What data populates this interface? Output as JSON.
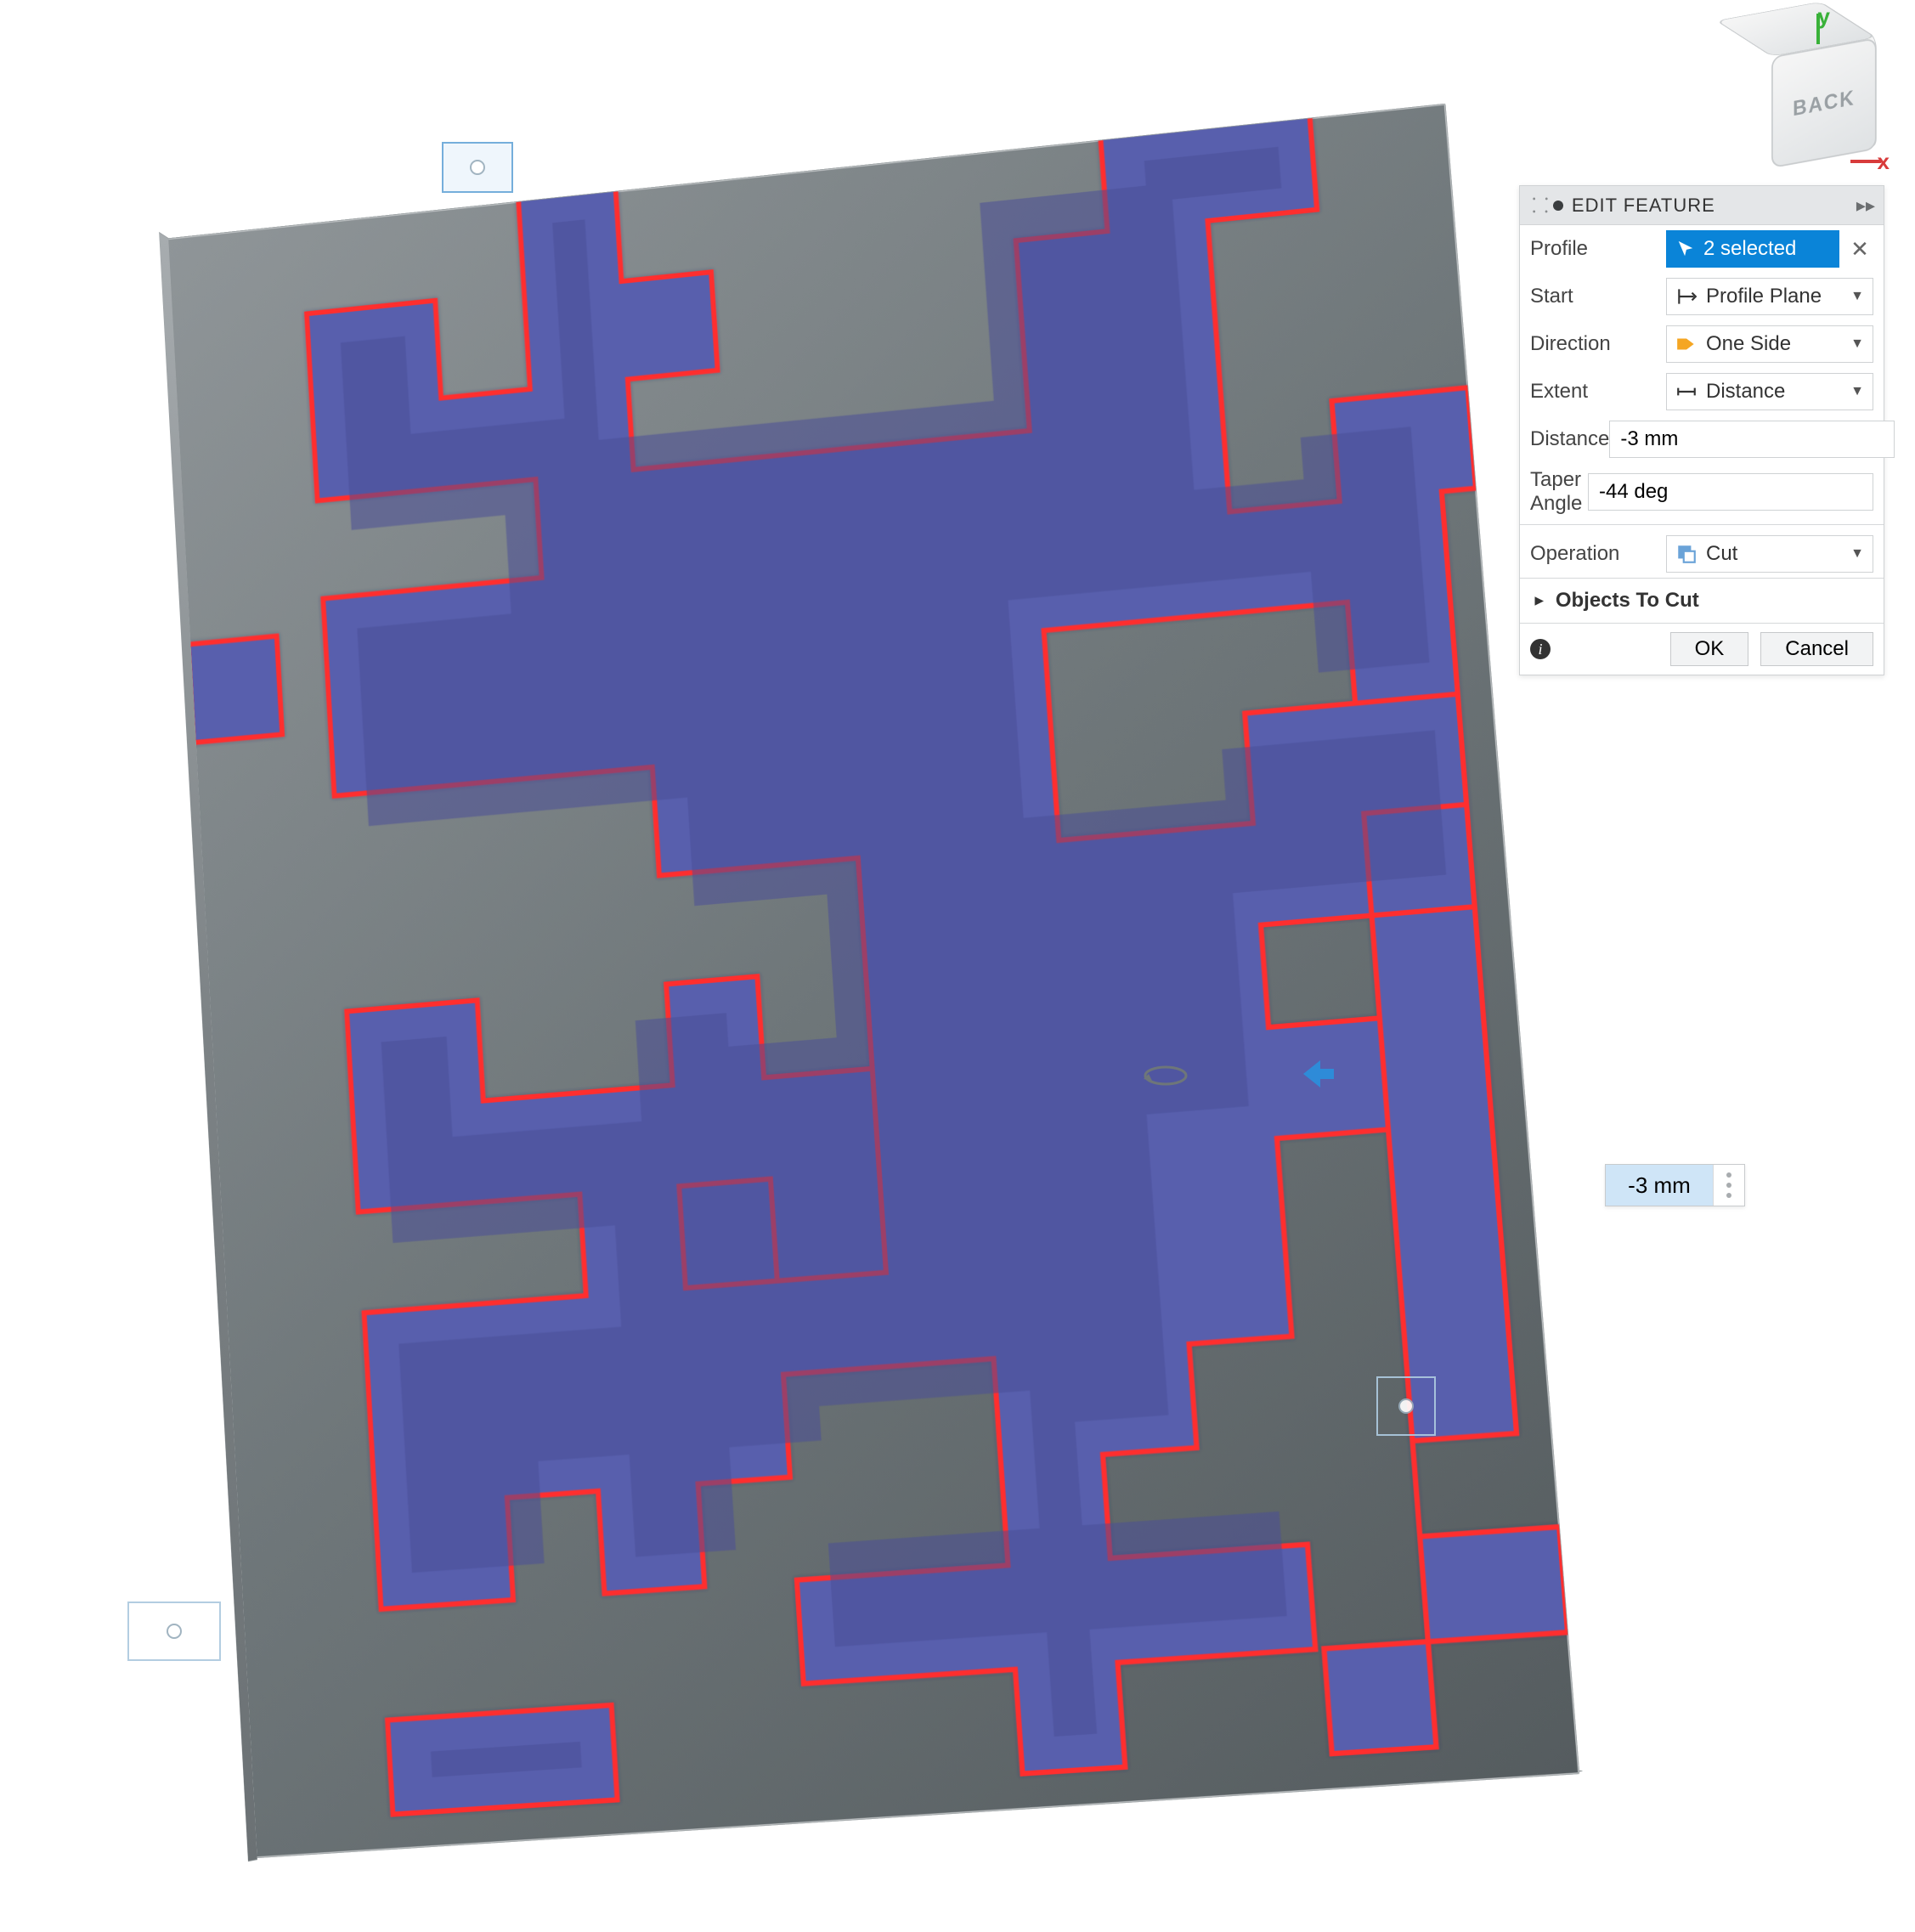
{
  "viewcube": {
    "face_label": "BACK",
    "axis_x": "x",
    "axis_y": "y"
  },
  "panel": {
    "title": "EDIT FEATURE",
    "profile_label": "Profile",
    "profile_value": "2 selected",
    "start_label": "Start",
    "start_value": "Profile Plane",
    "direction_label": "Direction",
    "direction_value": "One Side",
    "extent_label": "Extent",
    "extent_value": "Distance",
    "distance_label": "Distance",
    "distance_value": "-3 mm",
    "taper_label": "Taper Angle",
    "taper_value": "-44 deg",
    "operation_label": "Operation",
    "operation_value": "Cut",
    "objects_label": "Objects To Cut",
    "ok_label": "OK",
    "cancel_label": "Cancel"
  },
  "dimension": {
    "value": "-3 mm"
  },
  "colors": {
    "profile_fill": "#595fad",
    "profile_edge": "#ff2e2e",
    "slab": "#6e7679",
    "accent": "#0a84d8"
  }
}
